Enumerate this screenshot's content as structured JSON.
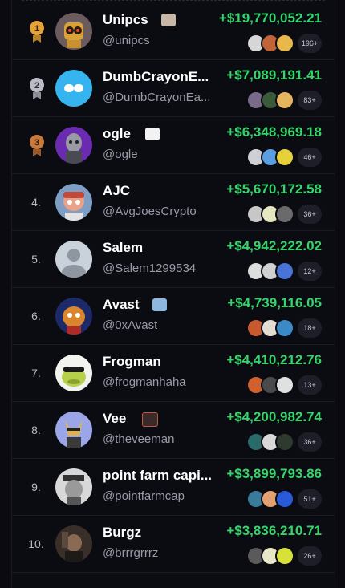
{
  "leaderboard": {
    "rows": [
      {
        "rank": "1.",
        "name": "Unipcs",
        "handle": "@unipcs",
        "pnl": "+$19,770,052.21",
        "more": "196+",
        "medal": "gold"
      },
      {
        "rank": "2.",
        "name": "DumbCrayonE...",
        "handle": "@DumbCrayonEa...",
        "pnl": "+$7,089,191.41",
        "more": "83+",
        "medal": "silver"
      },
      {
        "rank": "3.",
        "name": "ogle",
        "handle": "@ogle",
        "pnl": "+$6,348,969.18",
        "more": "46+",
        "medal": "bronze"
      },
      {
        "rank": "4.",
        "name": "AJC",
        "handle": "@AvgJoesCrypto",
        "pnl": "+$5,670,172.58",
        "more": "36+"
      },
      {
        "rank": "5.",
        "name": "Salem",
        "handle": "@Salem1299534",
        "pnl": "+$4,942,222.02",
        "more": "12+"
      },
      {
        "rank": "6.",
        "name": "Avast",
        "handle": "@0xAvast",
        "pnl": "+$4,739,116.05",
        "more": "18+"
      },
      {
        "rank": "7.",
        "name": "Frogman",
        "handle": "@frogmanhaha",
        "pnl": "+$4,410,212.76",
        "more": "13+"
      },
      {
        "rank": "8.",
        "name": "Vee",
        "handle": "@theveeman",
        "pnl": "+$4,200,982.74",
        "more": "36+"
      },
      {
        "rank": "9.",
        "name": "point farm capi...",
        "handle": "@pointfarmcap",
        "pnl": "+$3,899,793.86",
        "more": "51+"
      },
      {
        "rank": "10.",
        "name": "Burgz",
        "handle": "@brrrgrrrz",
        "pnl": "+$3,836,210.71",
        "more": "26+"
      }
    ]
  },
  "colors": {
    "background": "#0b0b12",
    "profit": "#36d56b",
    "gold": "#e6a23a",
    "silver": "#b9bcc6",
    "bronze": "#c9793a"
  }
}
